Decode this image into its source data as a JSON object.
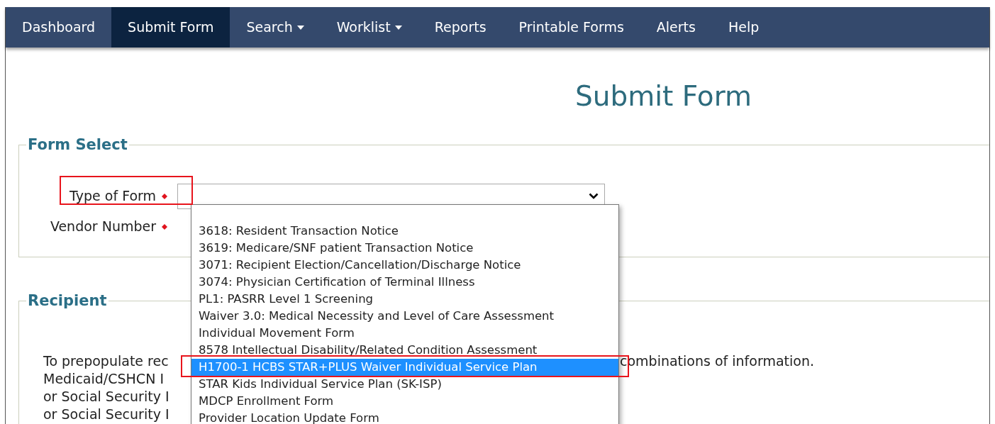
{
  "nav": [
    {
      "label": "Dashboard",
      "selected": false,
      "has_menu": false
    },
    {
      "label": "Submit Form",
      "selected": true,
      "has_menu": false
    },
    {
      "label": "Search",
      "selected": false,
      "has_menu": true
    },
    {
      "label": "Worklist",
      "selected": false,
      "has_menu": true
    },
    {
      "label": "Reports",
      "selected": false,
      "has_menu": false
    },
    {
      "label": "Printable Forms",
      "selected": false,
      "has_menu": false
    },
    {
      "label": "Alerts",
      "selected": false,
      "has_menu": false
    },
    {
      "label": "Help",
      "selected": false,
      "has_menu": false
    }
  ],
  "title": "Submit Form",
  "form_select": {
    "legend": "Form Select",
    "fields": [
      {
        "label": "Type of Form",
        "required": true,
        "kind": "select"
      },
      {
        "label": "Vendor Number",
        "required": true,
        "kind": "hidden"
      }
    ],
    "options": [
      {
        "label": "3618: Resident Transaction Notice",
        "selected": false
      },
      {
        "label": "3619: Medicare/SNF patient Transaction Notice",
        "selected": false
      },
      {
        "label": "3071: Recipient Election/Cancellation/Discharge Notice",
        "selected": false
      },
      {
        "label": "3074: Physician Certification of Terminal Illness",
        "selected": false
      },
      {
        "label": "PL1: PASRR Level 1 Screening",
        "selected": false
      },
      {
        "label": "Waiver 3.0: Medical Necessity and Level of Care Assessment",
        "selected": false
      },
      {
        "label": "Individual Movement Form",
        "selected": false
      },
      {
        "label": "8578 Intellectual Disability/Related Condition Assessment",
        "selected": false
      },
      {
        "label": "H1700-1 HCBS STAR+PLUS Waiver Individual Service Plan",
        "selected": true
      },
      {
        "label": "STAR Kids Individual Service Plan (SK-ISP)",
        "selected": false
      },
      {
        "label": "MDCP Enrollment Form",
        "selected": false
      },
      {
        "label": "Provider Location Update Form",
        "selected": false
      }
    ]
  },
  "recipient": {
    "legend": "Recipient",
    "lines": [
      "To prepopulate rec",
      "Medicaid/CSHCN I",
      "or Social Security I",
      "or Social Security I"
    ],
    "line_end": "combinations of information."
  }
}
